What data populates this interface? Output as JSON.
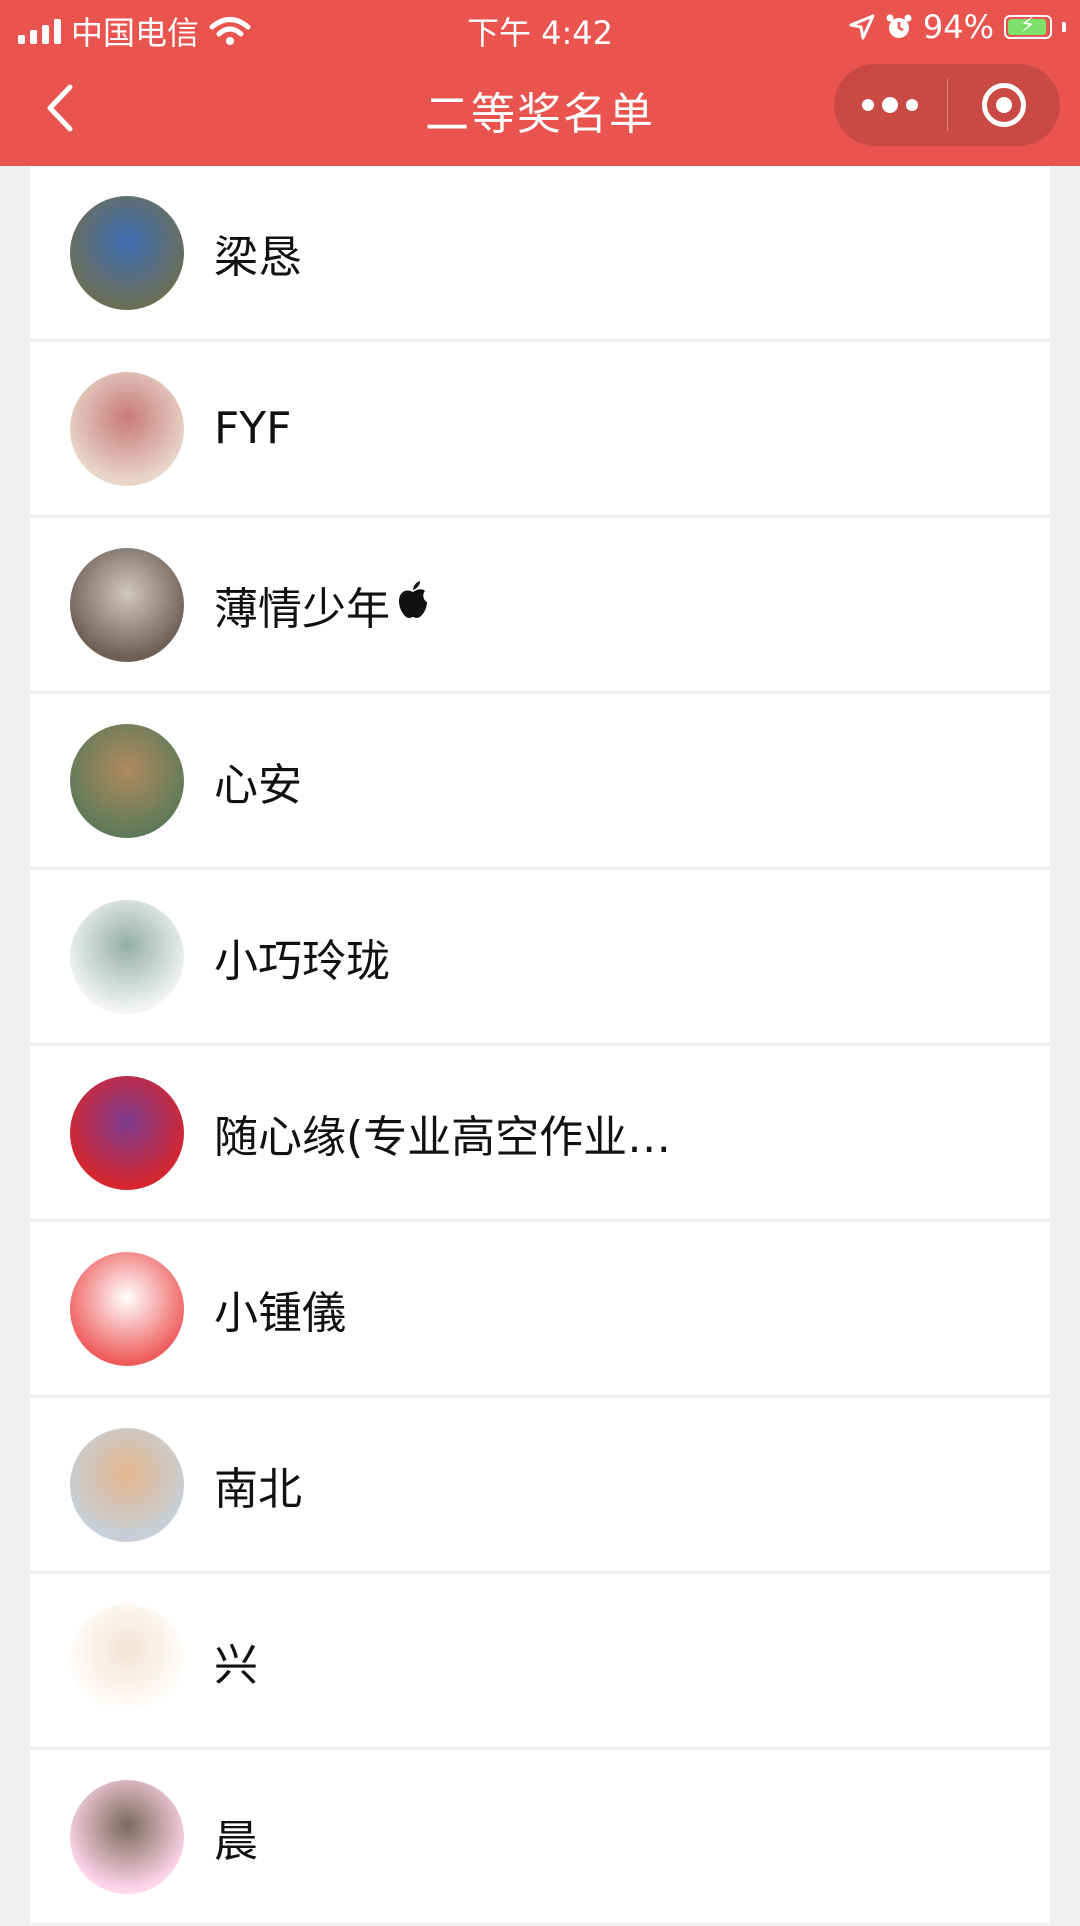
{
  "status_bar": {
    "carrier": "中国电信",
    "time": "下午 4:42",
    "battery": "94%",
    "battery_level": 0.94,
    "icons": [
      "signal-icon",
      "wifi-icon",
      "location-arrow-icon",
      "alarm-icon",
      "battery-charging-icon"
    ]
  },
  "navbar": {
    "title": "二等奖名单",
    "back_icon": "chevron-left-icon",
    "more_icon": "more-dots-icon",
    "close_icon": "target-close-icon"
  },
  "winners": [
    {
      "name": "梁恳",
      "avatar_colors": [
        "#6b6e57",
        "#3f6fb5"
      ]
    },
    {
      "name": "FYF",
      "avatar_colors": [
        "#e8d7c9",
        "#c97a7a"
      ]
    },
    {
      "name": "薄情少年",
      "badge": "apple-logo-icon",
      "avatar_colors": [
        "#6e5f55",
        "#d2c7bd"
      ]
    },
    {
      "name": "心安",
      "avatar_colors": [
        "#5f7a5a",
        "#b08a5f"
      ]
    },
    {
      "name": "小巧玲珑",
      "avatar_colors": [
        "#f3f4f2",
        "#93b0a6"
      ]
    },
    {
      "name": "随心缘(专业高空作业…",
      "avatar_colors": [
        "#d6262f",
        "#7b3c8f"
      ]
    },
    {
      "name": "小锺儀",
      "avatar_colors": [
        "#ef5c5c",
        "#ffffff"
      ]
    },
    {
      "name": "南北",
      "avatar_colors": [
        "#c7d0d8",
        "#e3b58e"
      ]
    },
    {
      "name": "兴",
      "avatar_colors": [
        "#ffffff",
        "#f3e3d1"
      ]
    },
    {
      "name": "晨",
      "avatar_colors": [
        "#ffd6ea",
        "#7a6a5c"
      ]
    }
  ]
}
